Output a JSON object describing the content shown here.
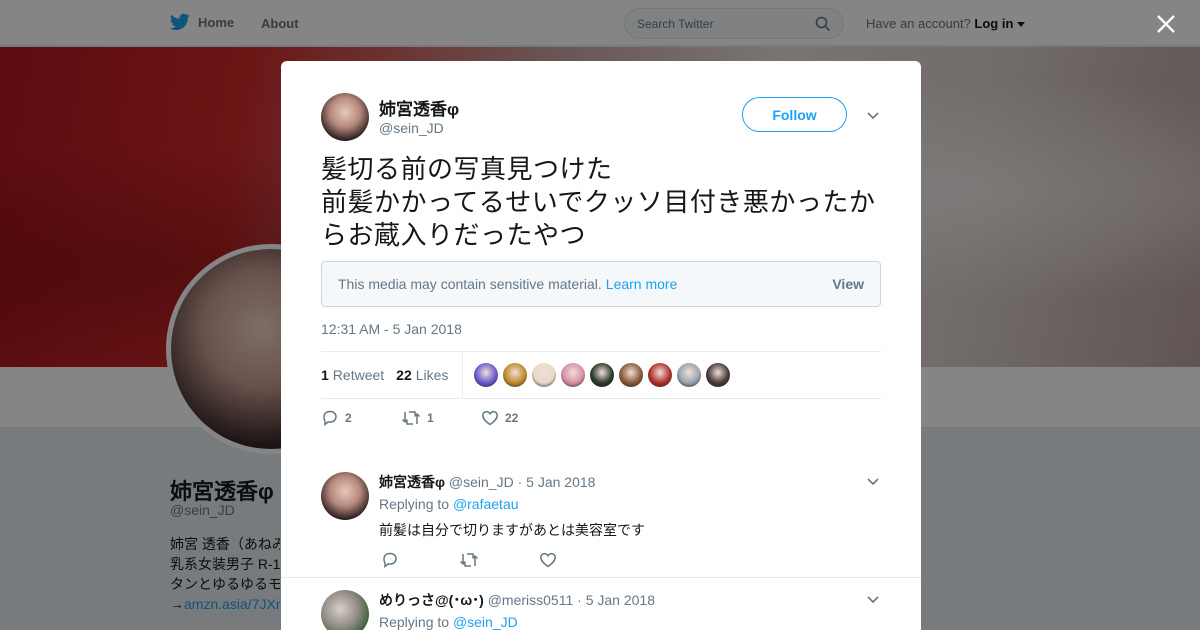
{
  "topbar": {
    "home_label": "Home",
    "about_label": "About",
    "search_placeholder": "Search Twitter",
    "have_account": "Have an account?",
    "login_label": "Log in"
  },
  "profile": {
    "name": "姉宮透香φ",
    "handle": "@sein_JD",
    "bio_lines": [
      "姉宮 透香（あねみ",
      "乳系女装男子 R-1",
      "タンとゆるゆるモ"
    ],
    "bio_link": "amzn.asia/7JXr",
    "bio_link_prefix": "→"
  },
  "tweet": {
    "author_name": "姉宮透香φ",
    "author_handle": "@sein_JD",
    "follow_label": "Follow",
    "text": "髪切る前の写真見つけた\n前髪かかってるせいでクッソ目付き悪かったからお蔵入りだったやつ",
    "sensitive_notice": "This media may contain sensitive material.",
    "learn_more": "Learn more",
    "view_label": "View",
    "timestamp": "12:31 AM - 5 Jan 2018",
    "retweet_count": "1",
    "retweet_label": "Retweet",
    "like_count": "22",
    "like_label": "Likes",
    "reply_action_count": "2",
    "retweet_action_count": "1",
    "like_action_count": "22"
  },
  "likers_colors": [
    "#6a5acd",
    "#c08a2c",
    "#e8d9c8",
    "#d98fa6",
    "#2b3a2b",
    "#8a5a3a",
    "#b0302a",
    "#9aa4ae",
    "#4a3a3a"
  ],
  "replies": [
    {
      "name": "姉宮透香φ",
      "handle": "@sein_JD",
      "date": "· 5 Jan 2018",
      "replying_prefix": "Replying to",
      "replying_to": "@rafaetau",
      "text": "前髪は自分で切りますがあとは美容室です"
    },
    {
      "name": "めりっさ@(･ω･)",
      "handle": "@meriss0511",
      "date": "· 5 Jan 2018",
      "replying_prefix": "Replying to",
      "replying_to": "@sein_JD"
    }
  ],
  "colors": {
    "accent": "#1da1f2",
    "muted": "#657786",
    "text": "#14171a"
  }
}
